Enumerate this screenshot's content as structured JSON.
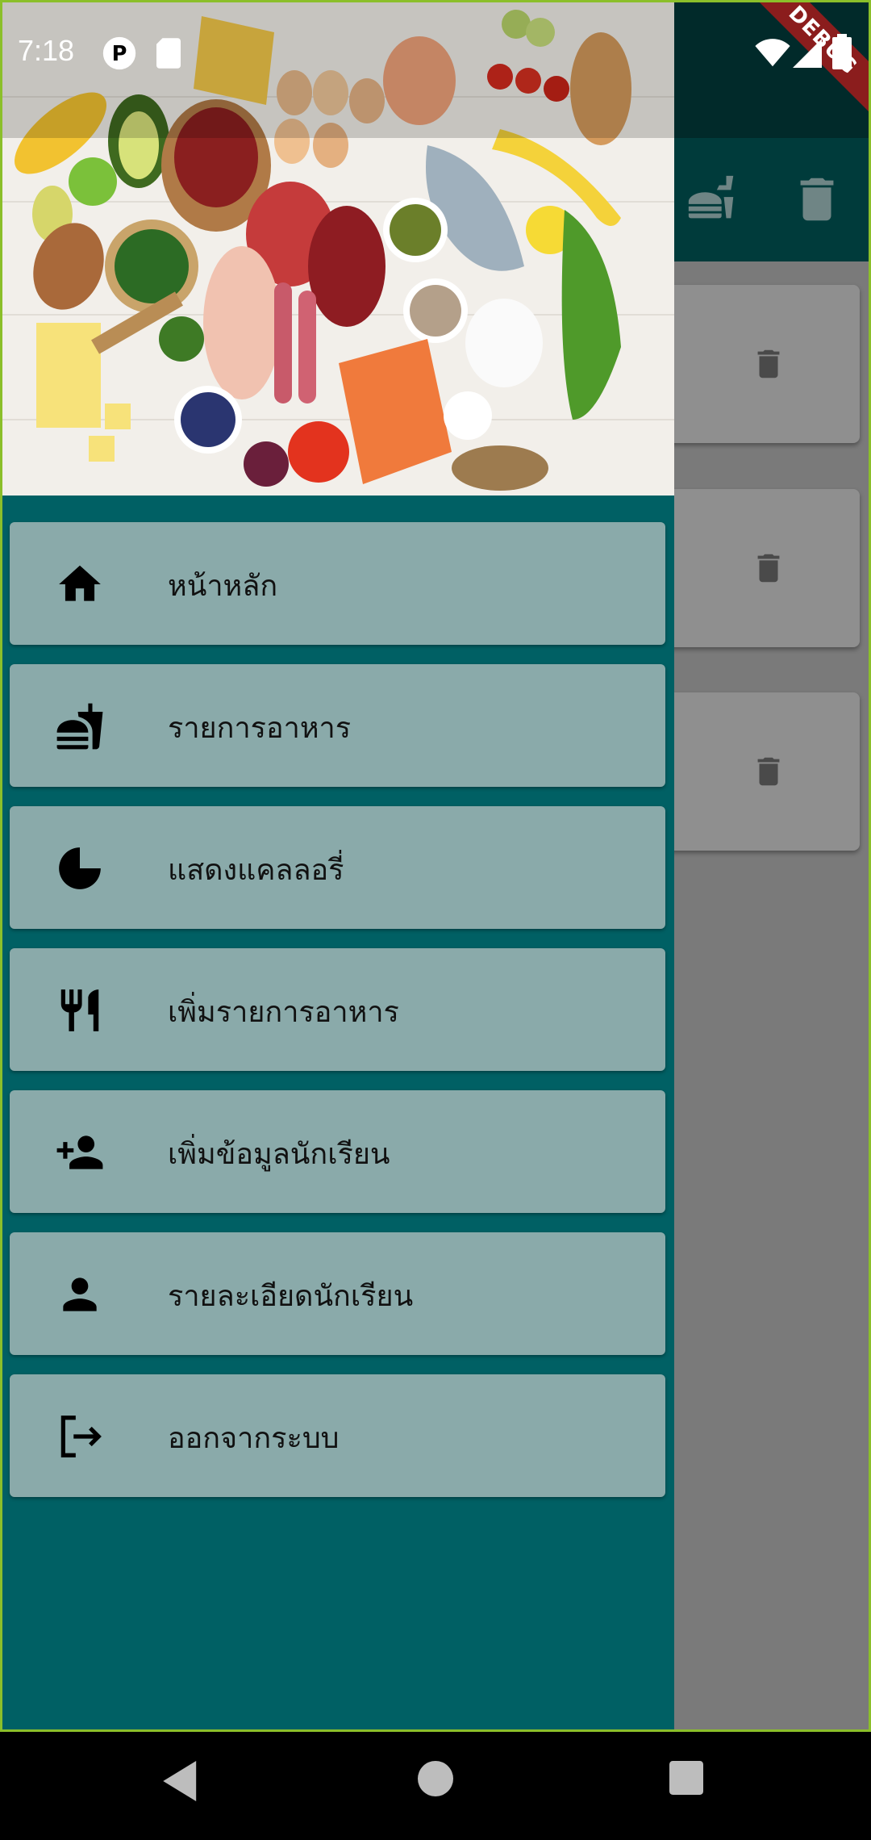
{
  "status_bar": {
    "time": "7:18"
  },
  "debug_banner": "DEBUG",
  "colors": {
    "drawer_bg": "#006064",
    "menu_item_bg": "#8aaaaa",
    "app_bar": "#003b3b",
    "status_bar": "#012a2a"
  },
  "drawer": {
    "header_image": "food-ingredients-photo",
    "menu": [
      {
        "icon": "home-icon",
        "label": "หน้าหลัก"
      },
      {
        "icon": "fastfood-icon",
        "label": "รายการอาหาร"
      },
      {
        "icon": "pie-chart-icon",
        "label": "แสดงแคลลอรี่"
      },
      {
        "icon": "restaurant-icon",
        "label": "เพิ่มรายการอาหาร"
      },
      {
        "icon": "person-add-icon",
        "label": "เพิ่มข้อมูลนักเรียน"
      },
      {
        "icon": "person-icon",
        "label": "รายละเอียดนักเรียน"
      },
      {
        "icon": "logout-icon",
        "label": "ออกจากระบบ"
      }
    ]
  },
  "background_app": {
    "appbar_actions": [
      "fastfood-icon",
      "delete-icon"
    ],
    "cards": [
      {
        "action_icon": "delete-icon"
      },
      {
        "action_icon": "delete-icon"
      },
      {
        "action_icon": "delete-icon"
      }
    ]
  }
}
